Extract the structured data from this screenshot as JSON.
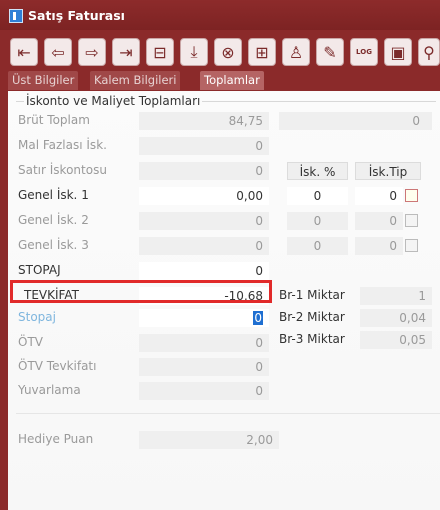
{
  "window": {
    "title": "Satış Faturası"
  },
  "toolbar": {
    "icons": [
      {
        "name": "first-record-icon"
      },
      {
        "name": "previous-record-icon"
      },
      {
        "name": "next-record-icon"
      },
      {
        "name": "last-record-icon"
      },
      {
        "name": "minus-box-icon"
      },
      {
        "name": "download-icon"
      },
      {
        "name": "cancel-circle-icon"
      },
      {
        "name": "plus-box-icon"
      },
      {
        "name": "user-icon"
      },
      {
        "name": "pencil-icon"
      },
      {
        "name": "log-icon",
        "label": "LOG"
      },
      {
        "name": "document-icon"
      },
      {
        "name": "link-icon"
      }
    ]
  },
  "tabs": [
    {
      "label": "Üst Bilgiler",
      "active": false
    },
    {
      "label": "Kalem Bilgileri",
      "active": false
    },
    {
      "label": "Toplamlar",
      "active": true
    }
  ],
  "group": {
    "title": "İskonto ve Maliyet Toplamları"
  },
  "headers": {
    "isk_pct": "İsk. %",
    "isk_tip": "İsk.Tip"
  },
  "fields": {
    "brut_toplam": {
      "label": "Brüt Toplam",
      "value": "84,75",
      "right": "0"
    },
    "mal_fazlasi": {
      "label": "Mal Fazlası İsk.",
      "value": "0"
    },
    "satir_iskontosu": {
      "label": "Satır İskontosu",
      "value": "0"
    },
    "genel_isk_1": {
      "label": "Genel İsk. 1",
      "value": "0,00",
      "pct": "0",
      "tip": "0"
    },
    "genel_isk_2": {
      "label": "Genel İsk. 2",
      "value": "0",
      "pct": "0",
      "tip": "0"
    },
    "genel_isk_3": {
      "label": "Genel İsk. 3",
      "value": "0",
      "pct": "0",
      "tip": "0"
    },
    "stopaj_upper": {
      "label": "STOPAJ",
      "value": "0"
    },
    "tevkifat": {
      "label": "TEVKİFAT",
      "value": "-10,68"
    },
    "stopaj": {
      "label": "Stopaj",
      "value": "0"
    },
    "otv": {
      "label": "ÖTV",
      "value": "0"
    },
    "otv_tevkifati": {
      "label": "ÖTV Tevkifatı",
      "value": "0"
    },
    "yuvarlama": {
      "label": "Yuvarlama",
      "value": "0"
    },
    "hediye_puan": {
      "label": "Hediye Puan",
      "value": "2,00"
    }
  },
  "miktar": [
    {
      "label": "Br-1 Miktar",
      "value": "1"
    },
    {
      "label": "Br-2 Miktar",
      "value": "0,04"
    },
    {
      "label": "Br-3 Miktar",
      "value": "0,05"
    }
  ],
  "colors": {
    "frame": "#8b2a2a",
    "highlight": "#e12a2a",
    "caret": "#1f6fd1"
  }
}
